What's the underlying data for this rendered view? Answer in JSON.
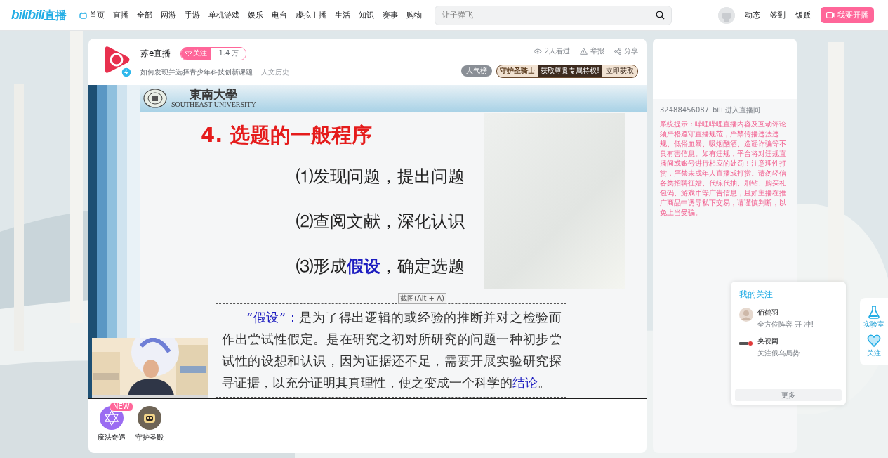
{
  "nav": {
    "logo": "bilibili",
    "logo_suffix": "直播",
    "items": [
      {
        "label": "首页",
        "kind": "icon-link"
      },
      {
        "label": "直播",
        "kind": "link"
      },
      {
        "label": "全部",
        "kind": "link"
      },
      {
        "label": "网游",
        "kind": "link"
      },
      {
        "label": "手游",
        "kind": "link"
      },
      {
        "label": "单机游戏",
        "kind": "link"
      },
      {
        "label": "娱乐",
        "kind": "link"
      },
      {
        "label": "电台",
        "kind": "link"
      },
      {
        "label": "虚拟主播",
        "kind": "link"
      },
      {
        "label": "生活",
        "kind": "link"
      },
      {
        "label": "知识",
        "kind": "link"
      },
      {
        "label": "赛事",
        "kind": "link"
      },
      {
        "label": "购物",
        "kind": "link"
      }
    ],
    "search": {
      "placeholder": "让子弹飞"
    },
    "user_links": [
      "动态",
      "签到",
      "饭贩"
    ],
    "live_button": "我要开播"
  },
  "room": {
    "streamer": "苏e直播",
    "follow_label": "关注",
    "followers": "1.4 万",
    "title": "如何发现并选择青少年科技创新课题",
    "category": "人文历史",
    "viewers": "2人看过",
    "report": "举报",
    "share": "分享",
    "rank_badge": "人气榜",
    "guard": {
      "title": "守护圣骑士",
      "text": "获取尊贵专属特权!",
      "action": "立即获取"
    }
  },
  "slide": {
    "logo_main": "東南大學",
    "logo_sub": "SOUTHEAST UNIVERSITY",
    "heading": "4. 选题的一般程序",
    "points": [
      "⑴发现问题，提出问题",
      "⑵查阅文献，深化认识",
      "⑶形成**假设**，确定选题"
    ],
    "definition": "**“假设”：**是为了得出逻辑的或经验的推断并对之检验而作出尝试性假定。是在研究之初对所研究的问题一种初步尝试性的设想和认识，因为证据还不足，需要开展实验研究探寻证据，以充分证明其真理性，使之变成一个科学的**结论**。",
    "tooltip": "截图(Alt + A)"
  },
  "gifts": [
    {
      "label": "魔法奇遇",
      "badge": "NEW",
      "kind": "magic"
    },
    {
      "label": "守护圣殿",
      "kind": "guard"
    }
  ],
  "chat": {
    "entry": "32488456087_bili 进入直播间",
    "notice": "系统提示：哔哩哔哩直播内容及互动评论须严格遵守直播规范，严禁传播违法违规、低俗血暴、吸烟酗酒、造谣诈骗等不良有害信息。如有违规，平台将对违规直播间或账号进行相应的处罚！注意理性打赏，严禁未成年人直播或打赏。请勿轻信各类招聘征婚、代练代抽、刷钻、购买礼包码、游戏币等广告信息，且如主播在推广商品中诱导私下交易，请谨慎判断，以免上当受骗。"
  },
  "follows": {
    "title": "我的关注",
    "items": [
      {
        "name": "佰鹤羽",
        "status": "全方位阵容 开 冲!",
        "kind": "person"
      },
      {
        "name": "央视网",
        "status": "关注俄乌局势",
        "kind": "channel"
      }
    ],
    "more": "更多"
  },
  "side_tools": [
    {
      "label": "实验室",
      "kind": "lab"
    },
    {
      "label": "关注",
      "kind": "heart"
    }
  ]
}
